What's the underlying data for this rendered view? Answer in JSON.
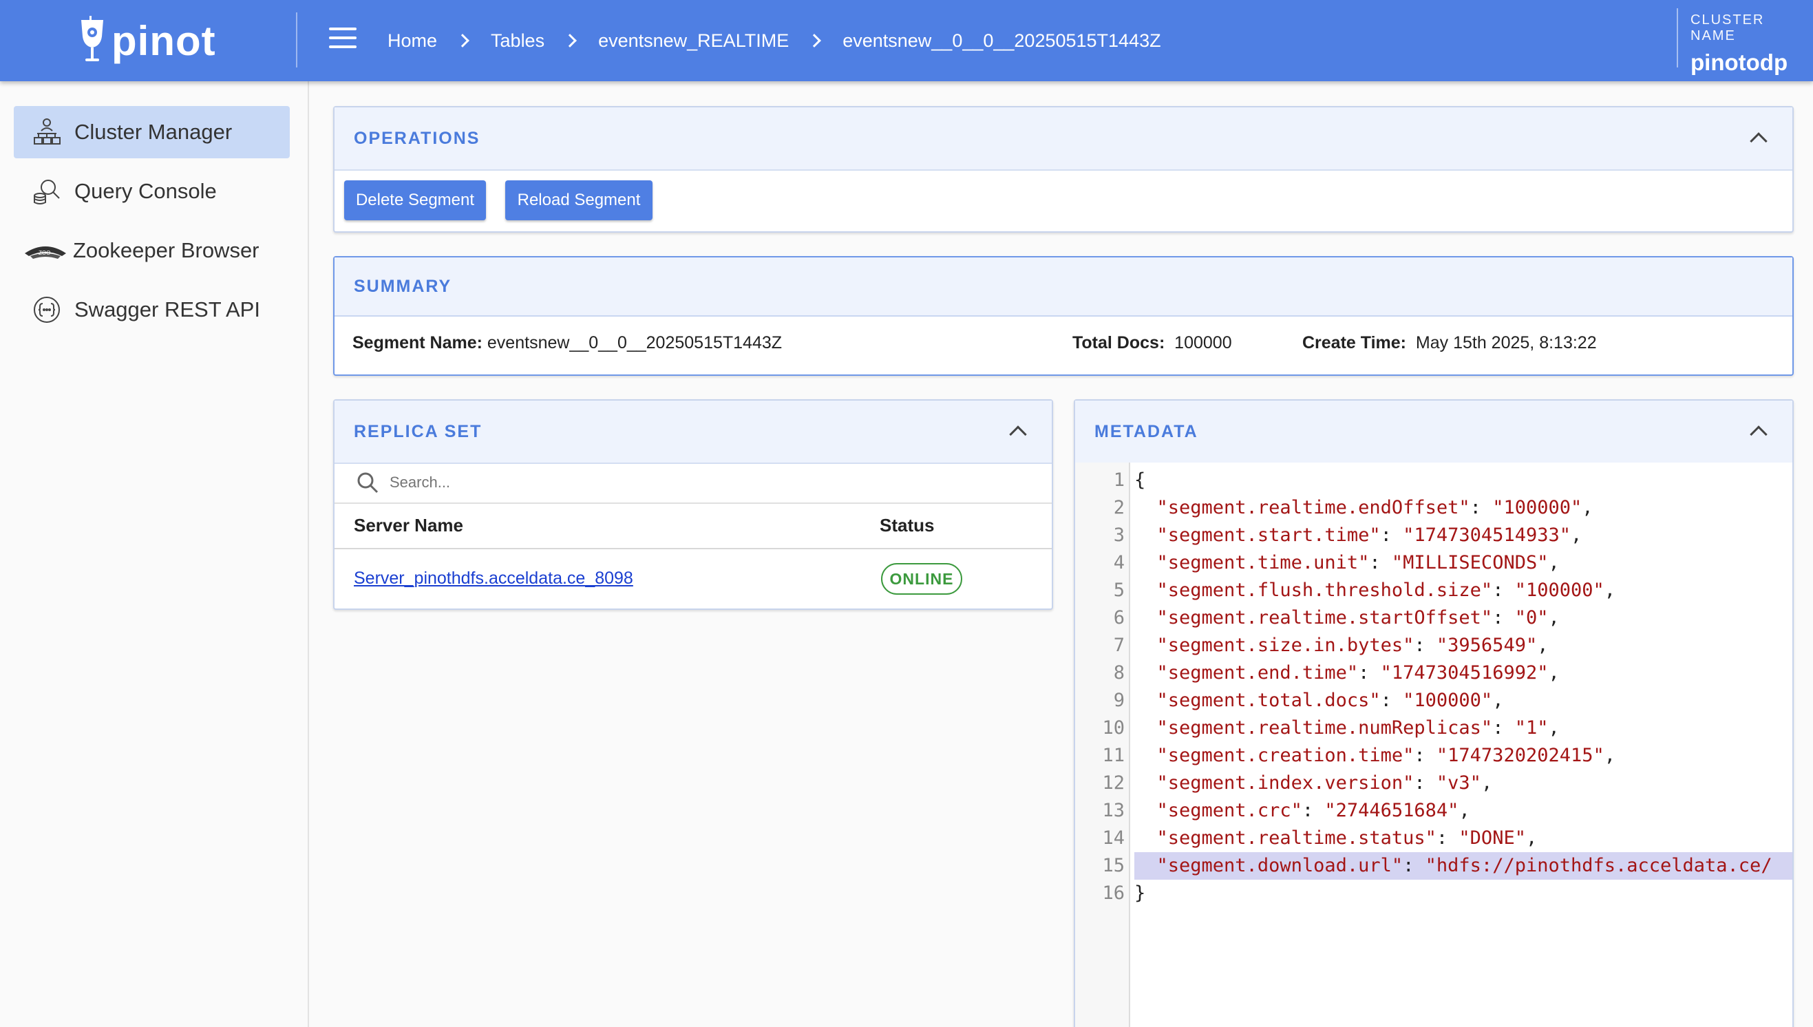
{
  "header": {
    "logo_text": "pinot",
    "breadcrumb": [
      "Home",
      "Tables",
      "eventsnew_REALTIME",
      "eventsnew__0__0__20250515T1443Z"
    ],
    "cluster_label": "CLUSTER NAME",
    "cluster_name": "pinotodp"
  },
  "sidebar": {
    "items": [
      {
        "label": "Cluster Manager",
        "icon": "cluster-icon",
        "active": true
      },
      {
        "label": "Query Console",
        "icon": "query-icon",
        "active": false
      },
      {
        "label": "Zookeeper Browser",
        "icon": "zookeeper-icon",
        "active": false
      },
      {
        "label": "Swagger REST API",
        "icon": "api-icon",
        "active": false
      }
    ]
  },
  "operations": {
    "title": "OPERATIONS",
    "delete_label": "Delete Segment",
    "reload_label": "Reload Segment"
  },
  "summary": {
    "title": "SUMMARY",
    "segment_name_label": "Segment Name:",
    "segment_name": "eventsnew__0__0__20250515T1443Z",
    "total_docs_label": "Total Docs:",
    "total_docs": "100000",
    "create_time_label": "Create Time:",
    "create_time": "May 15th 2025, 8:13:22"
  },
  "replica_set": {
    "title": "REPLICA SET",
    "search_placeholder": "Search...",
    "col_server": "Server Name",
    "col_status": "Status",
    "rows": [
      {
        "server": "Server_pinothdfs.acceldata.ce_8098",
        "status": "ONLINE"
      }
    ]
  },
  "metadata": {
    "title": "METADATA",
    "lines": [
      {
        "n": "1",
        "key": "",
        "val": "",
        "raw": "{"
      },
      {
        "n": "2",
        "key": "\"segment.realtime.endOffset\"",
        "val": "\"100000\"",
        "tail": ","
      },
      {
        "n": "3",
        "key": "\"segment.start.time\"",
        "val": "\"1747304514933\"",
        "tail": ","
      },
      {
        "n": "4",
        "key": "\"segment.time.unit\"",
        "val": "\"MILLISECONDS\"",
        "tail": ","
      },
      {
        "n": "5",
        "key": "\"segment.flush.threshold.size\"",
        "val": "\"100000\"",
        "tail": ","
      },
      {
        "n": "6",
        "key": "\"segment.realtime.startOffset\"",
        "val": "\"0\"",
        "tail": ","
      },
      {
        "n": "7",
        "key": "\"segment.size.in.bytes\"",
        "val": "\"3956549\"",
        "tail": ","
      },
      {
        "n": "8",
        "key": "\"segment.end.time\"",
        "val": "\"1747304516992\"",
        "tail": ","
      },
      {
        "n": "9",
        "key": "\"segment.total.docs\"",
        "val": "\"100000\"",
        "tail": ","
      },
      {
        "n": "10",
        "key": "\"segment.realtime.numReplicas\"",
        "val": "\"1\"",
        "tail": ","
      },
      {
        "n": "11",
        "key": "\"segment.creation.time\"",
        "val": "\"1747320202415\"",
        "tail": ","
      },
      {
        "n": "12",
        "key": "\"segment.index.version\"",
        "val": "\"v3\"",
        "tail": ","
      },
      {
        "n": "13",
        "key": "\"segment.crc\"",
        "val": "\"2744651684\"",
        "tail": ","
      },
      {
        "n": "14",
        "key": "\"segment.realtime.status\"",
        "val": "\"DONE\"",
        "tail": ","
      },
      {
        "n": "15",
        "key": "\"segment.download.url\"",
        "val": "\"hdfs://pinothdfs.acceldata.ce/",
        "tail": "",
        "highlight": true
      },
      {
        "n": "16",
        "key": "",
        "val": "",
        "raw": "}"
      }
    ]
  },
  "colors": {
    "brand": "#4f7fe3",
    "online": "#3c9a3e",
    "json_string": "#a31515"
  }
}
